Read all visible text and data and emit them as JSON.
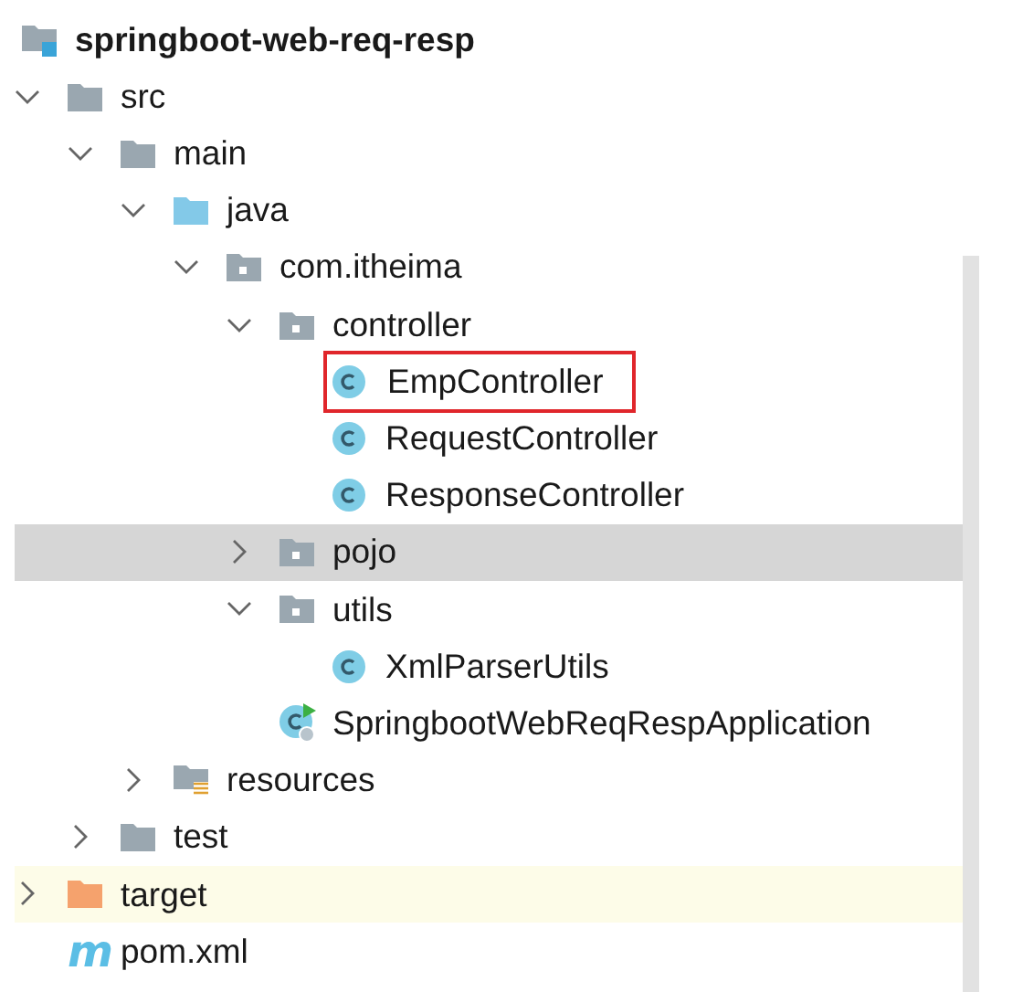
{
  "project_tree": {
    "name": "springboot-web-req-resp",
    "kind": "project",
    "children": [
      {
        "name": "src",
        "kind": "folder",
        "expanded": true,
        "children": [
          {
            "name": "main",
            "kind": "folder",
            "expanded": true,
            "children": [
              {
                "name": "java",
                "kind": "source-folder",
                "expanded": true,
                "children": [
                  {
                    "name": "com.itheima",
                    "kind": "package",
                    "expanded": true,
                    "children": [
                      {
                        "name": "controller",
                        "kind": "package",
                        "expanded": true,
                        "children": [
                          {
                            "name": "EmpController",
                            "kind": "class",
                            "boxed": true
                          },
                          {
                            "name": "RequestController",
                            "kind": "class"
                          },
                          {
                            "name": "ResponseController",
                            "kind": "class"
                          }
                        ]
                      },
                      {
                        "name": "pojo",
                        "kind": "package",
                        "expanded": false,
                        "selected": true
                      },
                      {
                        "name": "utils",
                        "kind": "package",
                        "expanded": true,
                        "children": [
                          {
                            "name": "XmlParserUtils",
                            "kind": "class"
                          }
                        ]
                      },
                      {
                        "name": "SpringbootWebReqRespApplication",
                        "kind": "app-class"
                      }
                    ]
                  }
                ]
              },
              {
                "name": "resources",
                "kind": "resources",
                "expanded": false
              }
            ]
          },
          {
            "name": "test",
            "kind": "folder",
            "expanded": false
          }
        ]
      },
      {
        "name": "target",
        "kind": "excluded-folder",
        "expanded": false
      },
      {
        "name": "pom.xml",
        "kind": "maven",
        "icon_glyph": "m"
      }
    ]
  }
}
